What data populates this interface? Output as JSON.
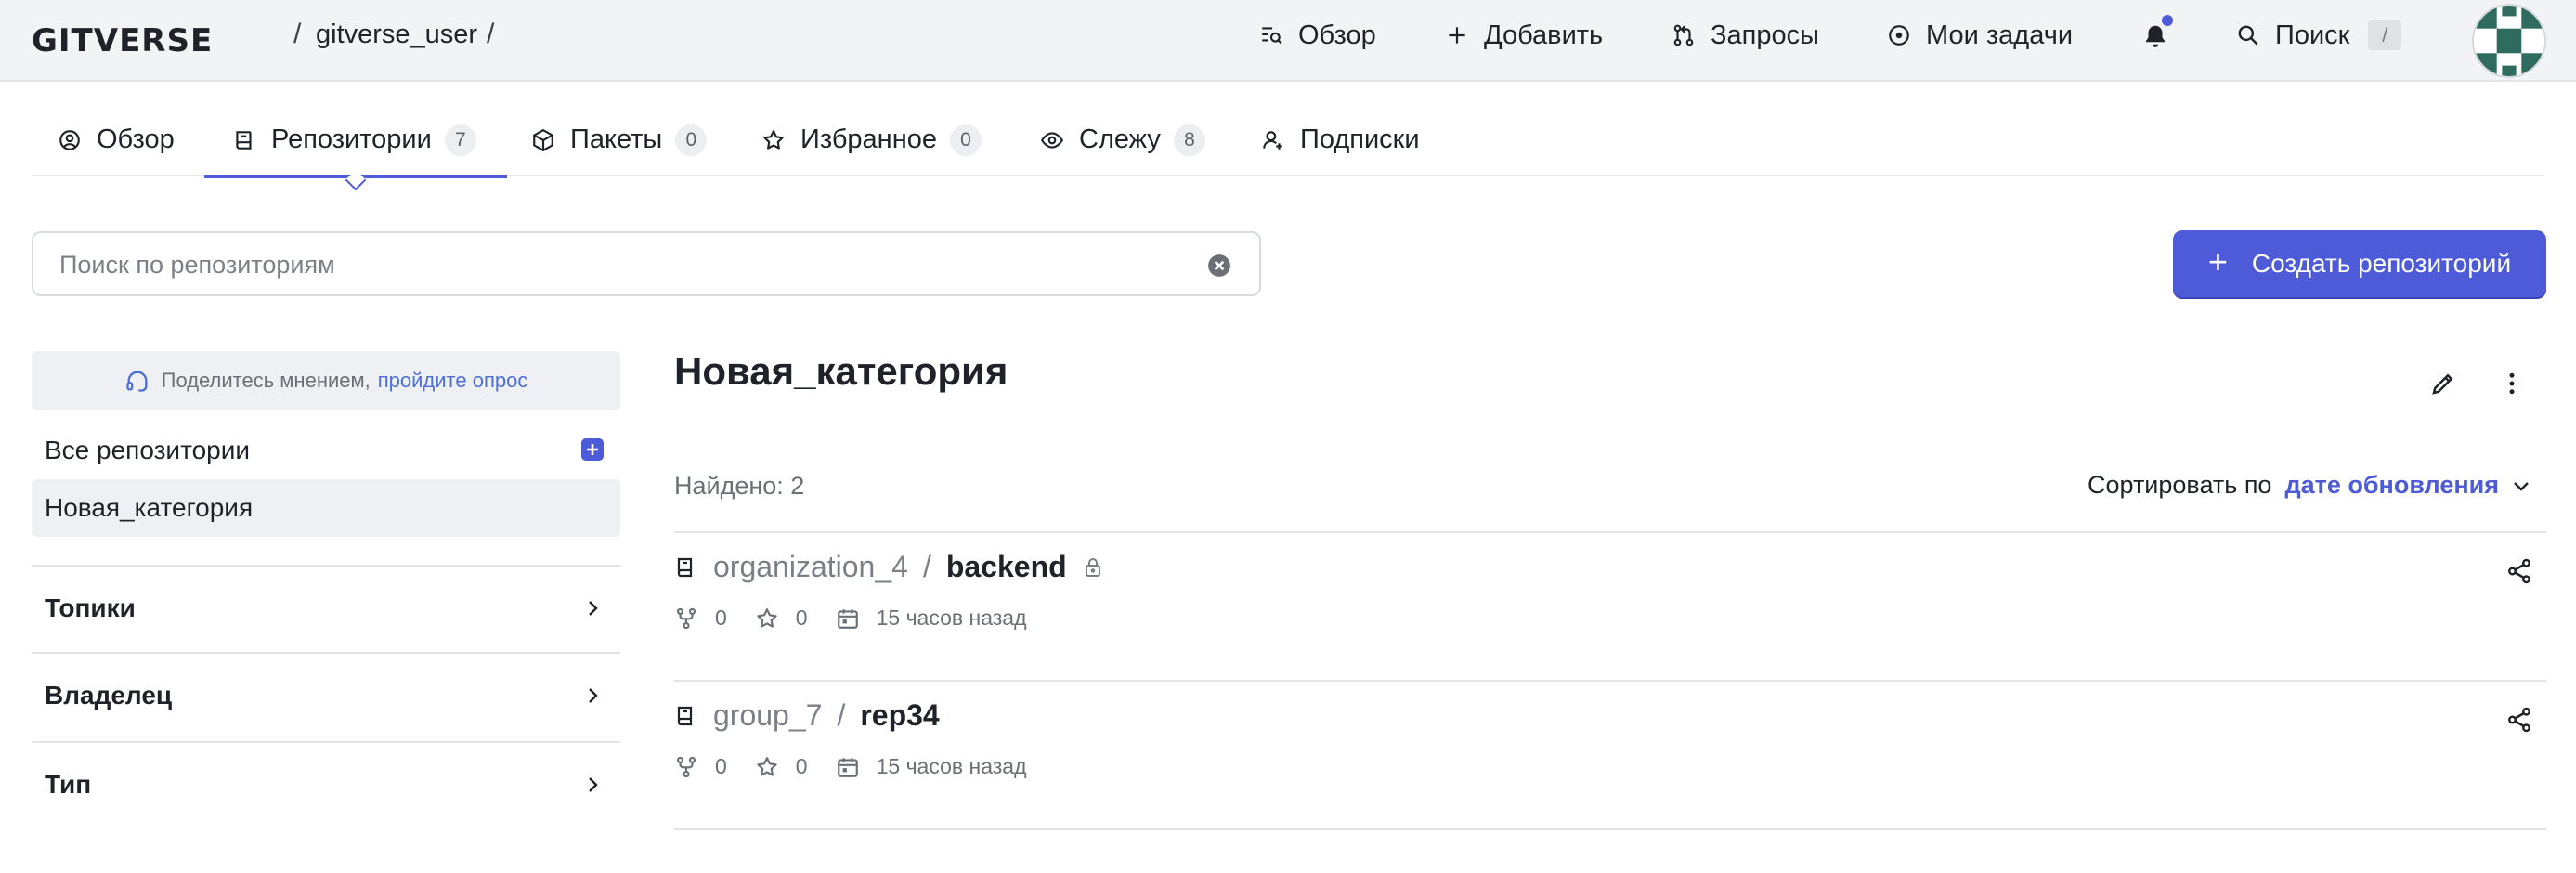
{
  "header": {
    "logo": "GITVERSE",
    "separator": "/",
    "user": "gitverse_user",
    "nav": [
      {
        "label": "Обзор",
        "icon": "search-doc-icon"
      },
      {
        "label": "Добавить",
        "icon": "plus-icon"
      },
      {
        "label": "Запросы",
        "icon": "pull-request-icon"
      },
      {
        "label": "Мои задачи",
        "icon": "issue-icon"
      }
    ],
    "search_label": "Поиск",
    "search_shortcut": "/"
  },
  "tabs": [
    {
      "label": "Обзор",
      "icon": "user-circle-icon",
      "count": null,
      "active": false
    },
    {
      "label": "Репозитории",
      "icon": "book-icon",
      "count": "7",
      "active": true
    },
    {
      "label": "Пакеты",
      "icon": "package-icon",
      "count": "0",
      "active": false
    },
    {
      "label": "Избранное",
      "icon": "star-icon",
      "count": "0",
      "active": false
    },
    {
      "label": "Слежу",
      "icon": "eye-icon",
      "count": "8",
      "active": false
    },
    {
      "label": "Подписки",
      "icon": "user-plus-icon",
      "count": null,
      "active": false
    }
  ],
  "search": {
    "placeholder": "Поиск по репозиториям",
    "value": ""
  },
  "create_button": {
    "label": "Создать репозиторий"
  },
  "sidebar": {
    "feedback_text": "Поделитесь мнением,",
    "feedback_link": "пройдите опрос",
    "categories": [
      {
        "label": "Все репозитории",
        "selected": false
      },
      {
        "label": "Новая_категория",
        "selected": true
      }
    ],
    "filters": [
      {
        "label": "Топики"
      },
      {
        "label": "Владелец"
      },
      {
        "label": "Тип"
      }
    ]
  },
  "main": {
    "title": "Новая_категория",
    "found": "Найдено: 2",
    "sort_label": "Сортировать по",
    "sort_value": "дате обновления",
    "repos": [
      {
        "owner": "organization_4",
        "name": "backend",
        "private": true,
        "forks": "0",
        "stars": "0",
        "updated": "15 часов назад"
      },
      {
        "owner": "group_7",
        "name": "rep34",
        "private": false,
        "forks": "0",
        "stars": "0",
        "updated": "15 часов назад"
      }
    ]
  },
  "colors": {
    "accent": "#4d5bd8",
    "link": "#4d6fd8",
    "header_bg": "#f2f3f5"
  }
}
